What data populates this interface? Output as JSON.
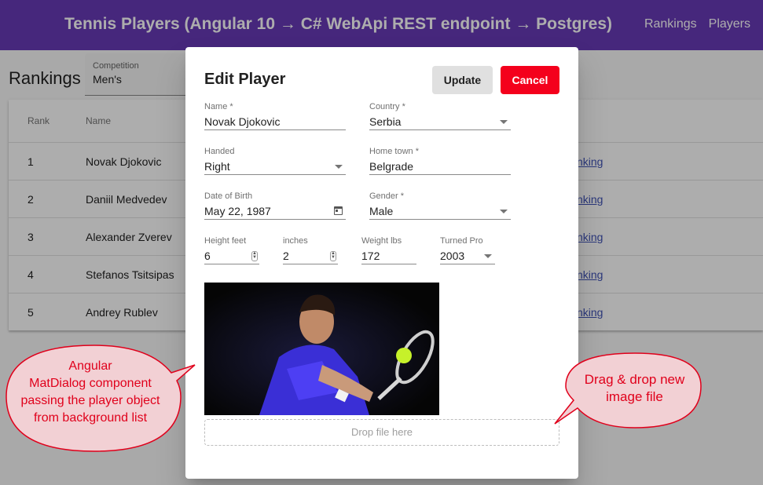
{
  "app": {
    "title": "Tennis Players (Angular 10 → C# WebApi REST endpoint → Postgres)",
    "nav": [
      "Rankings",
      "Players"
    ],
    "primary_color": "#673ab7"
  },
  "page": {
    "heading": "Rankings",
    "competition": {
      "label": "Competition",
      "value": "Men's"
    }
  },
  "table": {
    "columns": [
      "Rank",
      "Name"
    ],
    "link_text": "nking",
    "rows": [
      {
        "rank": "1",
        "name": "Novak Djokovic"
      },
      {
        "rank": "2",
        "name": "Daniil Medvedev"
      },
      {
        "rank": "3",
        "name": "Alexander Zverev"
      },
      {
        "rank": "4",
        "name": "Stefanos Tsitsipas"
      },
      {
        "rank": "5",
        "name": "Andrey Rublev"
      }
    ]
  },
  "dialog": {
    "title": "Edit Player",
    "update_label": "Update",
    "cancel_label": "Cancel",
    "fields": {
      "name": {
        "label": "Name *",
        "value": "Novak Djokovic"
      },
      "country": {
        "label": "Country *",
        "value": "Serbia"
      },
      "handed": {
        "label": "Handed",
        "value": "Right"
      },
      "hometown": {
        "label": "Home town *",
        "value": "Belgrade"
      },
      "dob": {
        "label": "Date of Birth",
        "value": "May 22, 1987"
      },
      "gender": {
        "label": "Gender *",
        "value": "Male"
      },
      "height_feet": {
        "label": "Height feet",
        "value": "6"
      },
      "height_inches": {
        "label": "inches",
        "value": "2"
      },
      "weight": {
        "label": "Weight lbs",
        "value": "172"
      },
      "turned_pro": {
        "label": "Turned Pro",
        "value": "2003"
      }
    },
    "drop_zone_text": "Drop file here"
  },
  "callouts": {
    "left": [
      "Angular",
      "MatDialog component",
      "passing the player object",
      "from background list"
    ],
    "right": [
      "Drag & drop new",
      "image file"
    ]
  }
}
